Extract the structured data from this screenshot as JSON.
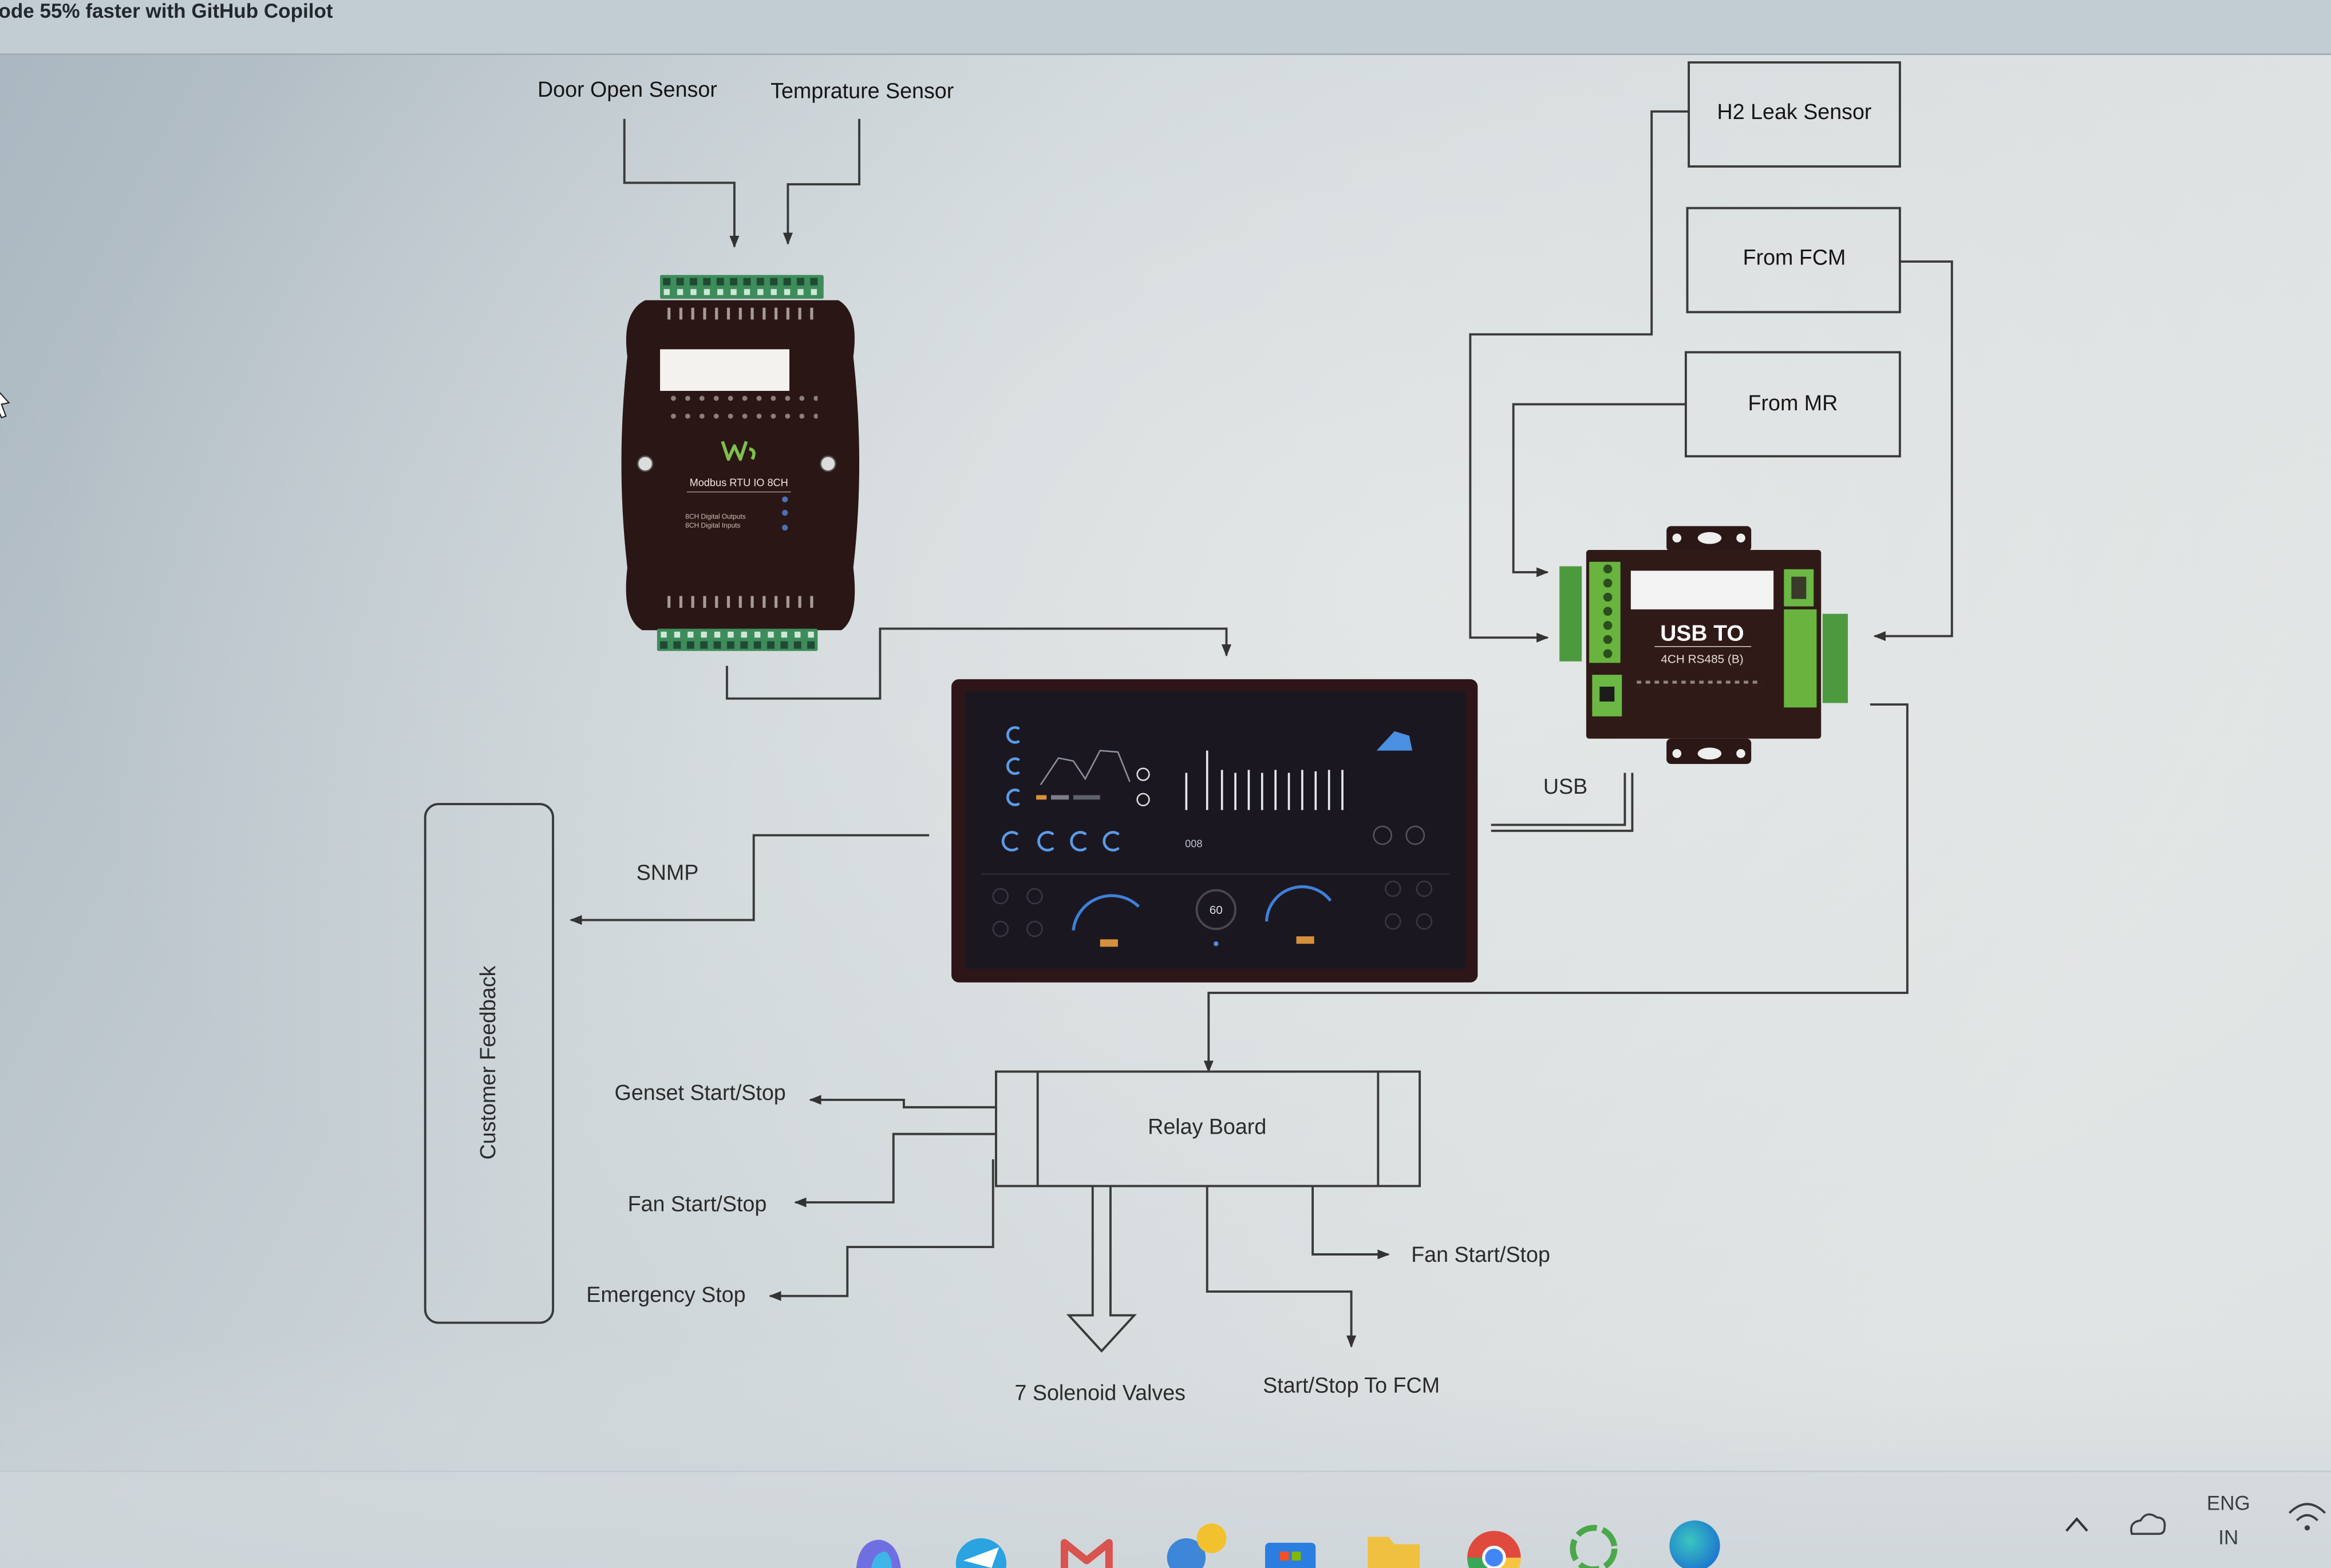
{
  "banner": {
    "text": "ode 55% faster with GitHub Copilot"
  },
  "diagram": {
    "door_sensor": "Door Open Sensor",
    "temp_sensor": "Temprature Sensor",
    "modbus_module": {
      "model": "Modbus RTU IO 8CH",
      "outputs_line": "8CH Digital Outputs",
      "inputs_line": "8CH Digital Inputs"
    },
    "h2_sensor": "H2 Leak Sensor",
    "from_fcm": "From FCM",
    "from_mr": "From MR",
    "usb_converter": {
      "title": "USB TO",
      "subtitle": "4CH RS485 (B)"
    },
    "usb_link": "USB",
    "snmp_link": "SNMP",
    "display": {
      "dial_value": "60",
      "counter_value": "008"
    },
    "customer_feedback": "Customer Feedback",
    "relay_board": "Relay Board",
    "relay_outputs_left": [
      "Genset Start/Stop",
      "Fan Start/Stop",
      "Emergency Stop"
    ],
    "relay_outputs_bottom": [
      "7 Solenoid Valves",
      "Start/Stop To FCM"
    ],
    "relay_outputs_right": [
      "Fan Start/Stop"
    ]
  },
  "taskbar": {
    "apps": [
      "copilot-icon",
      "telegram-icon",
      "gmail-icon",
      "colorful-app-icon",
      "store-icon",
      "file-explorer-icon",
      "chrome-icon",
      "ring-app-icon",
      "edge-icon"
    ],
    "tray": {
      "icons": [
        "chevron-up-icon",
        "onedrive-icon",
        "wifi-icon"
      ],
      "lang_primary": "ENG",
      "lang_region": "IN"
    }
  },
  "colors": {
    "background": "#c9d1d5",
    "line": "#3a3a3a",
    "module_body": "#2a1614",
    "terminal_green": "#3e8b5c",
    "converter_green": "#69b43f",
    "display_accent": "#4a8fe0"
  }
}
